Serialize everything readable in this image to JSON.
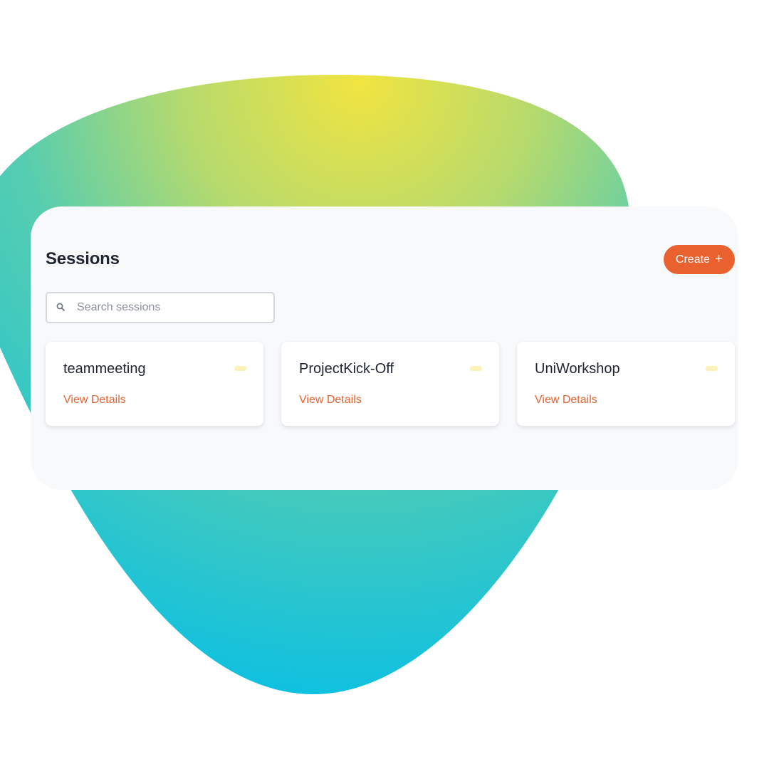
{
  "page": {
    "title": "Sessions"
  },
  "toolbar": {
    "create_label": "Create",
    "create_icon": "plus-icon"
  },
  "search": {
    "placeholder": "Search sessions",
    "value": "",
    "icon": "search-icon"
  },
  "sessions": [
    {
      "name": "teammeeting",
      "link_label": "View Details"
    },
    {
      "name": "ProjectKick-Off",
      "link_label": "View Details"
    },
    {
      "name": "UniWorkshop",
      "link_label": "View Details"
    }
  ],
  "colors": {
    "accent": "#e8612f",
    "panel_bg": "#f8f9fb",
    "title_text": "#1f2533",
    "status_dot": "#fbf2b8",
    "gradient_top": "#f1e440",
    "gradient_bottom": "#0cc0e2"
  }
}
